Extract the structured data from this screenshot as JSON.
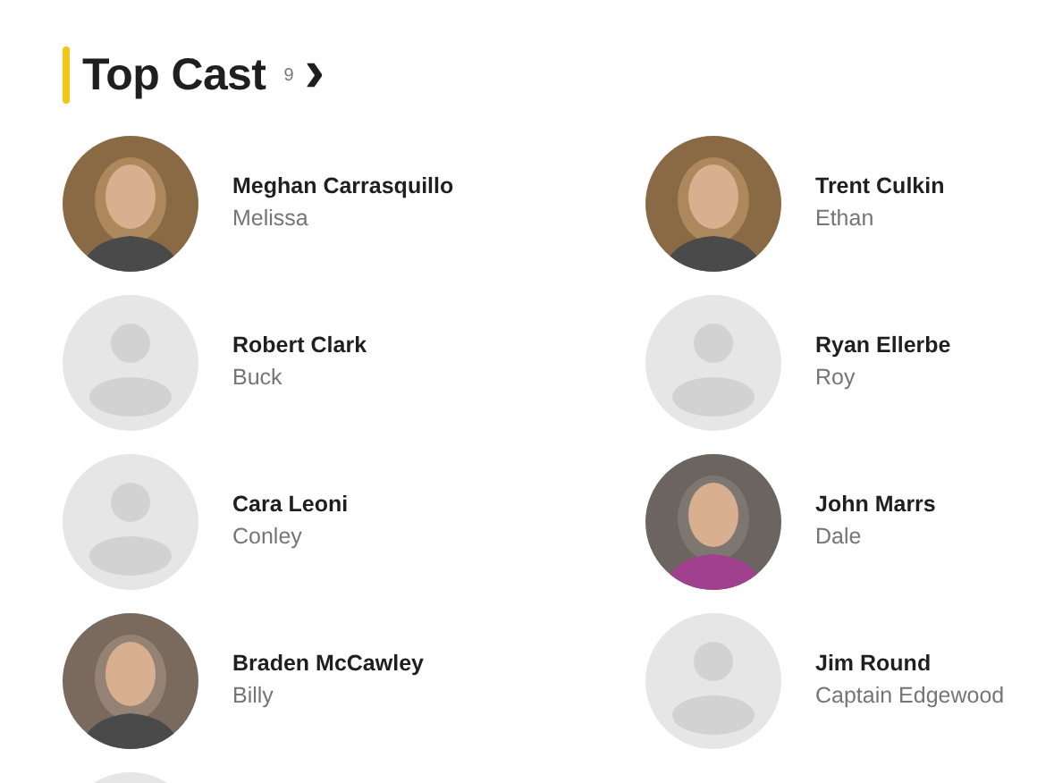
{
  "section": {
    "title": "Top Cast",
    "count": "9",
    "more": "›"
  },
  "cast": [
    {
      "name": "Meghan Carrasquillo",
      "role": "Melissa"
    },
    {
      "name": "Trent Culkin",
      "role": "Ethan"
    },
    {
      "kind": "placeholder",
      "name": "Robert Clark",
      "role": "Buck"
    },
    {
      "kind": "placeholder",
      "name": "Ryan Ellerbe",
      "role": "Roy"
    },
    {
      "kind": "placeholder",
      "name": "Cara Leoni",
      "role": "Conley"
    },
    {
      "name": "John Marrs",
      "role": "Dale"
    },
    {
      "name": "Braden McCawley",
      "role": "Billy"
    },
    {
      "kind": "placeholder",
      "name": "Jim Round",
      "role": "Captain Edgewood"
    },
    {
      "kind": "placeholder"
    }
  ]
}
